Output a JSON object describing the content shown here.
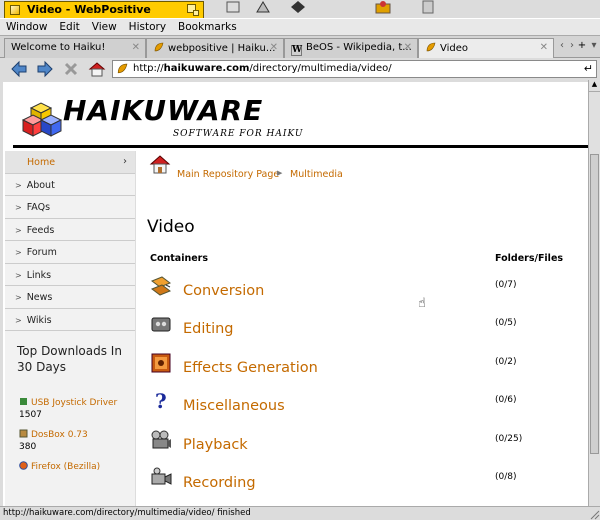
{
  "window": {
    "title": "Video - WebPositive"
  },
  "menu": [
    "Window",
    "Edit",
    "View",
    "History",
    "Bookmarks"
  ],
  "tabs": [
    {
      "label": "Welcome to Haiku!",
      "active": false
    },
    {
      "label": "webpositive | Haiku...",
      "active": false
    },
    {
      "label": "BeOS - Wikipedia, t...",
      "active": false
    },
    {
      "label": "Video",
      "active": true
    }
  ],
  "tab_controls": {
    "prev": "‹",
    "next": "›",
    "add": "+",
    "menu": "▾"
  },
  "nav": {
    "url_prefix": "http://",
    "url_host": "haikuware.com",
    "url_path": "/directory/multimedia/video/",
    "go": "↵"
  },
  "header": {
    "logo": "HAIKUWARE",
    "tagline": "SOFTWARE FOR HAIKU"
  },
  "sidebar": {
    "items": [
      {
        "label": "Home"
      },
      {
        "label": "About"
      },
      {
        "label": "FAQs"
      },
      {
        "label": "Feeds"
      },
      {
        "label": "Forum"
      },
      {
        "label": "Links"
      },
      {
        "label": "News"
      },
      {
        "label": "Wikis"
      }
    ],
    "top_title": "Top Downloads In 30 Days",
    "downloads": [
      {
        "name": "USB Joystick Driver",
        "count": "1507"
      },
      {
        "name": "DosBox 0.73",
        "count": "380"
      },
      {
        "name": "Firefox (Bezilla)",
        "count": ""
      }
    ]
  },
  "content": {
    "breadcrumb": [
      "Main Repository Page",
      "Multimedia"
    ],
    "title": "Video",
    "col_containers": "Containers",
    "col_folders": "Folders/Files",
    "rows": [
      {
        "name": "Conversion",
        "count": "(0/7)",
        "icon": "conversion-icon"
      },
      {
        "name": "Editing",
        "count": "(0/5)",
        "icon": "editing-icon"
      },
      {
        "name": "Effects Generation",
        "count": "(0/2)",
        "icon": "effects-icon"
      },
      {
        "name": "Miscellaneous",
        "count": "(0/6)",
        "icon": "question-icon"
      },
      {
        "name": "Playback",
        "count": "(0/25)",
        "icon": "projector-icon"
      },
      {
        "name": "Recording",
        "count": "(0/8)",
        "icon": "camera-icon"
      }
    ]
  },
  "status": "http://haikuware.com/directory/multimedia/video/ finished",
  "colors": {
    "link": "#c46a00",
    "tab_yellow": "#ffcb00"
  }
}
